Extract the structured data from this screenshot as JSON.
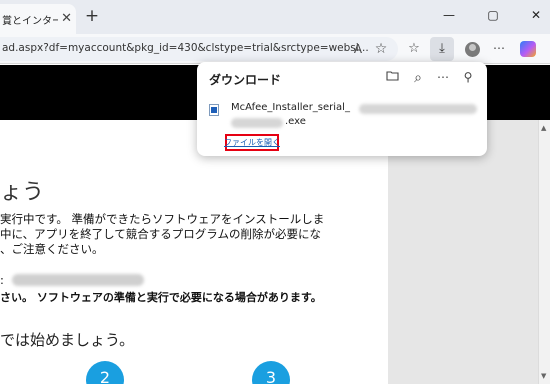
{
  "browser": {
    "tab_title": "賞とインターネ",
    "tab_close": "✕",
    "new_tab": "+",
    "window_controls": {
      "minimize": "—",
      "maximize": "▢",
      "close": "✕"
    },
    "url": "ad.aspx?df=myaccount&pkg_id=430&clstype=trial&srctype=websi..."
  },
  "download_panel": {
    "title": "ダウンロード",
    "file_name_prefix": "McAfee_Installer_serial_",
    "file_extension": ".exe",
    "open_file_link": "ファイルを開く"
  },
  "page": {
    "heading": "ょう",
    "paragraph_lines": [
      "実行中です。 準備ができたらソフトウェアをインストールしま",
      "中に、アプリを終了して競合するプログラムの削除が必要にな",
      "、ご注意ください。"
    ],
    "field_label": ":",
    "note": "さい。 ソフトウェアの準備と実行で必要になる場合があります。",
    "start_text": "では始めましょう。",
    "steps": [
      "2",
      "3"
    ]
  },
  "colors": {
    "accent_blue": "#1a9fe0",
    "highlight_red": "#e60012",
    "link_blue": "#1a5fb4"
  },
  "icons": {
    "reader_mode": "A",
    "favorite": "☆",
    "favorites_list": "☆",
    "download": "⤓",
    "folder": "folder-icon",
    "search": "⌕",
    "more": "⋯",
    "pin": "⚲",
    "scroll_up": "▲",
    "scroll_down": "▼"
  }
}
